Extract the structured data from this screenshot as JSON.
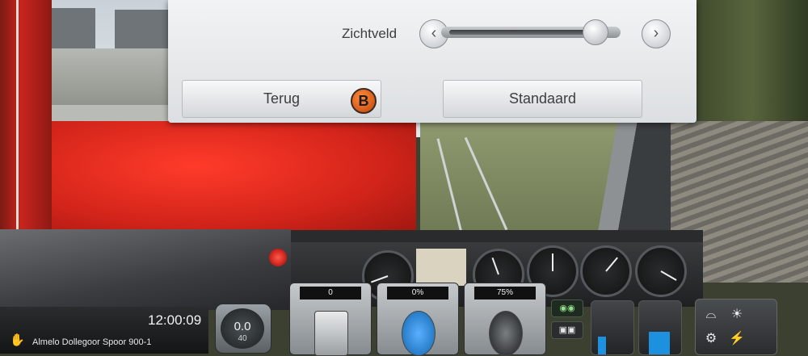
{
  "settings": {
    "fov_label": "Zichtveld",
    "fov_level": 0.88,
    "back_button": "Terug",
    "back_shortcut": "B",
    "default_button": "Standaard"
  },
  "hud": {
    "clock": "12:00:09",
    "route": "Almelo Dollegoor Spoor 900-1",
    "speed": "0.0",
    "speed_limit": "40",
    "throttle": "0",
    "brake": "0%",
    "train_brake": "75%"
  },
  "colors": {
    "overlay_bg": "#e6e8ea",
    "badge": "#e0601c",
    "accent_blue": "#1e90e0"
  }
}
